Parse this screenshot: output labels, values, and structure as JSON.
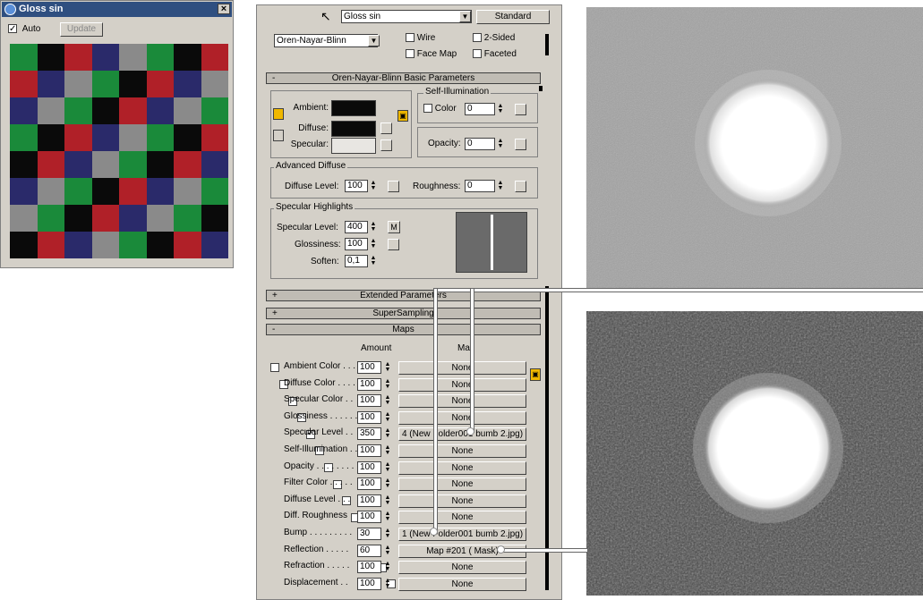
{
  "preview": {
    "title": "Gloss sin",
    "close": "×",
    "auto_label": "Auto",
    "auto_checked": true,
    "update_label": "Update",
    "checker_colors": [
      "#1a8a3a",
      "#2a2a6a",
      "#0a0a0a",
      "#8a8a8a",
      "#b02028",
      "#2a2a6a",
      "#1a8a3a",
      "#0a0a0a"
    ]
  },
  "toolbar": {
    "material_name": "Gloss sin",
    "type_button": "Standard"
  },
  "shader": {
    "value": "Oren-Nayar-Blinn",
    "wire": "Wire",
    "two_sided": "2-Sided",
    "face_map": "Face Map",
    "faceted": "Faceted"
  },
  "basic": {
    "header": "Oren-Nayar-Blinn Basic Parameters",
    "ambient": "Ambient:",
    "diffuse": "Diffuse:",
    "specular": "Specular:",
    "self_illum_title": "Self-Illumination",
    "color_label": "Color",
    "color_value": "0",
    "opacity_label": "Opacity:",
    "opacity_value": "0",
    "adv_diffuse": "Advanced Diffuse",
    "diffuse_level_label": "Diffuse Level:",
    "diffuse_level_value": "100",
    "roughness_label": "Roughness:",
    "roughness_value": "0",
    "spec_highlights": "Specular Highlights",
    "spec_level_label": "Specular Level:",
    "spec_level_value": "400",
    "m_label": "M",
    "glossiness_label": "Glossiness:",
    "glossiness_value": "100",
    "soften_label": "Soften:",
    "soften_value": "0,1"
  },
  "rollouts": {
    "extended": "Extended Parameters",
    "supersampling": "SuperSampling",
    "maps": "Maps",
    "plus": "+",
    "minus": "-"
  },
  "maps": {
    "amount_header": "Amount",
    "map_header": "Map",
    "rows": [
      {
        "name": "Ambient Color . . .",
        "amount": "100",
        "map": "None",
        "checked": false
      },
      {
        "name": "Diffuse Color . . . .",
        "amount": "100",
        "map": "None",
        "checked": false
      },
      {
        "name": "Specular Color . .",
        "amount": "100",
        "map": "None",
        "checked": false
      },
      {
        "name": "Glossiness . . . . . .",
        "amount": "100",
        "map": "None",
        "checked": false
      },
      {
        "name": "Specular Level . .",
        "amount": "350",
        "map": "4 (New Folder001 bumb 2.jpg)",
        "checked": true
      },
      {
        "name": "Self-Illumination . .",
        "amount": "100",
        "map": "None",
        "checked": false
      },
      {
        "name": "Opacity . . . . . . . .",
        "amount": "100",
        "map": "None",
        "checked": false
      },
      {
        "name": "Filter Color . . . . .",
        "amount": "100",
        "map": "None",
        "checked": false
      },
      {
        "name": "Diffuse Level . . .",
        "amount": "100",
        "map": "None",
        "checked": false
      },
      {
        "name": "Diff. Roughness",
        "amount": "100",
        "map": "None",
        "checked": false
      },
      {
        "name": "Bump . . . . . . . . .",
        "amount": "30",
        "map": "1 (New Folder001 bumb 2.jpg)",
        "checked": true
      },
      {
        "name": "Reflection . . . . .",
        "amount": "60",
        "map": "Map #201 ( Mask)",
        "checked": true
      },
      {
        "name": "Refraction . . . . .",
        "amount": "100",
        "map": "None",
        "checked": false
      },
      {
        "name": "Displacement . .",
        "amount": "100",
        "map": "None",
        "checked": false
      }
    ]
  },
  "colors": {
    "panel_bg": "#d4d0c8",
    "title_bar": "#2f4f80",
    "photo_top_bg": "#9a9a9a",
    "photo_bottom_bg": "#4a4a4a"
  }
}
